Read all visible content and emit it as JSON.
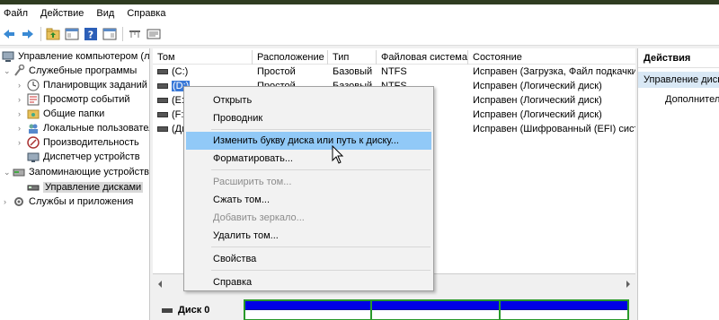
{
  "menu": [
    "Файл",
    "Действие",
    "Вид",
    "Справка"
  ],
  "toolbar": {
    "icons": [
      "back-arrow-icon",
      "forward-arrow-icon",
      "folder-up-icon",
      "console-tree-icon",
      "help-icon",
      "properties-icon",
      "connect-icon",
      "view-icon"
    ]
  },
  "tree": {
    "items": [
      {
        "label": "Управление компьютером (лс",
        "icon": "computer-management-icon"
      },
      {
        "label": "Служебные программы",
        "icon": "tools-icon"
      },
      {
        "label": "Планировщик заданий",
        "icon": "clock-icon"
      },
      {
        "label": "Просмотр событий",
        "icon": "event-viewer-icon"
      },
      {
        "label": "Общие папки",
        "icon": "shared-folder-icon"
      },
      {
        "label": "Локальные пользовател",
        "icon": "users-icon"
      },
      {
        "label": "Производительность",
        "icon": "performance-icon"
      },
      {
        "label": "Диспетчер устройств",
        "icon": "device-manager-icon"
      },
      {
        "label": "Запоминающие устройств",
        "icon": "storage-icon"
      },
      {
        "label": "Управление дисками",
        "icon": "disk-management-icon"
      },
      {
        "label": "Службы и приложения",
        "icon": "services-icon"
      }
    ]
  },
  "table": {
    "columns": [
      "Том",
      "Расположение",
      "Тип",
      "Файловая система",
      "Состояние"
    ],
    "rows": [
      [
        "(C:)",
        "Простой",
        "Базовый",
        "NTFS",
        "Исправен (Загрузка, Файл подкачки,"
      ],
      [
        "(D:)",
        "Простой",
        "Базовый",
        "NTFS",
        "Исправен (Логический диск)"
      ],
      [
        "(E:)",
        "",
        "",
        "",
        "Исправен (Логический диск)"
      ],
      [
        "(F:)",
        "",
        "",
        "",
        "Исправен (Логический диск)"
      ],
      [
        "(Ди",
        "",
        "",
        "",
        "Исправен (Шифрованный (EFI) систе"
      ]
    ]
  },
  "lower": {
    "disk_label": "Диск 0"
  },
  "actions": {
    "title": "Действия",
    "section": "Управление диск",
    "item": "Дополнител"
  },
  "context_menu": {
    "items": [
      "Открыть",
      "Проводник",
      "Изменить букву диска или путь к диску...",
      "Форматировать...",
      "Расширить том...",
      "Сжать том...",
      "Добавить зеркало...",
      "Удалить том...",
      "Свойства",
      "Справка"
    ]
  }
}
